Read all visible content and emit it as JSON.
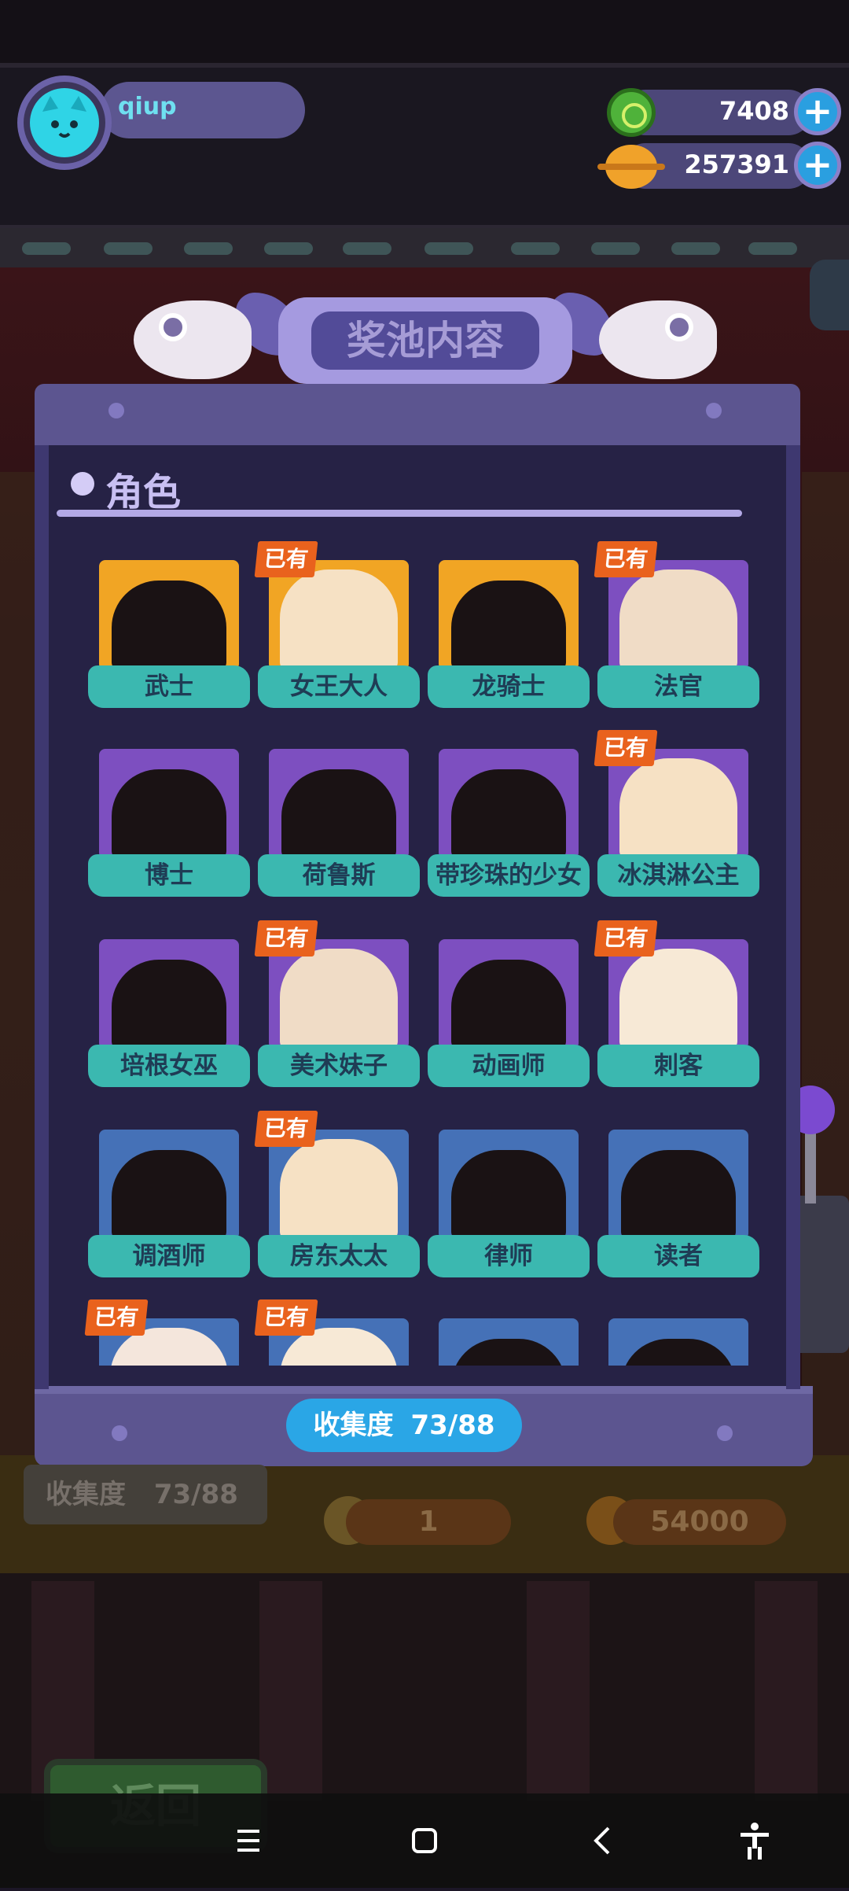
{
  "player": {
    "name": "qiup",
    "avatar_icon": "cat-avatar-icon"
  },
  "currencies": [
    {
      "icon": "donut-gem-icon",
      "value": "7408",
      "color": "#4fb23a"
    },
    {
      "icon": "planet-coin-icon",
      "value": "257391",
      "color": "#f0a22a"
    }
  ],
  "panel": {
    "title": "奖池内容",
    "section": "角色",
    "owned_label": "已有",
    "collection_label": "收集度",
    "collection_value": "73/88"
  },
  "characters": [
    {
      "name": "武士",
      "bg": "gold",
      "owned": false
    },
    {
      "name": "女王大人",
      "bg": "gold",
      "owned": true
    },
    {
      "name": "龙骑士",
      "bg": "gold",
      "owned": false
    },
    {
      "name": "法官",
      "bg": "purple",
      "owned": true
    },
    {
      "name": "博士",
      "bg": "purple",
      "owned": false
    },
    {
      "name": "荷鲁斯",
      "bg": "purple",
      "owned": false
    },
    {
      "name": "带珍珠的少女",
      "bg": "purple",
      "owned": false
    },
    {
      "name": "冰淇淋公主",
      "bg": "purple",
      "owned": true
    },
    {
      "name": "培根女巫",
      "bg": "purple",
      "owned": false
    },
    {
      "name": "美术妹子",
      "bg": "purple",
      "owned": true
    },
    {
      "name": "动画师",
      "bg": "purple",
      "owned": false
    },
    {
      "name": "刺客",
      "bg": "purple",
      "owned": true
    },
    {
      "name": "调酒师",
      "bg": "blue",
      "owned": false
    },
    {
      "name": "房东太太",
      "bg": "blue",
      "owned": true
    },
    {
      "name": "律师",
      "bg": "blue",
      "owned": false
    },
    {
      "name": "读者",
      "bg": "blue",
      "owned": false
    },
    {
      "name": "",
      "bg": "blue",
      "owned": true
    },
    {
      "name": "",
      "bg": "blue",
      "owned": true
    },
    {
      "name": "",
      "bg": "blue",
      "owned": false
    },
    {
      "name": "",
      "bg": "blue",
      "owned": false
    }
  ],
  "background": {
    "collection_label": "收集度",
    "collection_value": "73/88",
    "ticket_count": "1",
    "coin_price": "54000",
    "back_button": "返回"
  },
  "system_nav": {
    "recents_icon": "≡",
    "home_icon": "▢",
    "back_icon": "‹",
    "accessibility_icon": "accessibility-icon"
  }
}
